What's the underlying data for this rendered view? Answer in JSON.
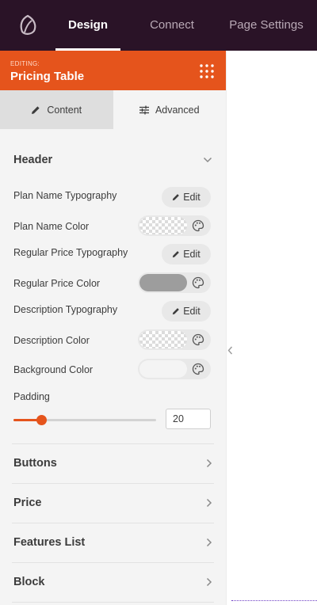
{
  "topbar": {
    "logo_icon": "seedprod-leaf-icon",
    "tabs": [
      {
        "label": "Design",
        "active": true
      },
      {
        "label": "Connect",
        "active": false
      },
      {
        "label": "Page Settings",
        "active": false
      }
    ]
  },
  "editing": {
    "label": "EDITING:",
    "title": "Pricing Table",
    "menu_icon": "grid-dots-icon"
  },
  "subtabs": [
    {
      "label": "Content",
      "icon": "pencil-icon",
      "active": true
    },
    {
      "label": "Advanced",
      "icon": "sliders-icon",
      "active": false
    }
  ],
  "header_section": {
    "title": "Header",
    "expanded": true,
    "rows": [
      {
        "label": "Plan Name Typography",
        "control": "edit",
        "button_label": "Edit"
      },
      {
        "label": "Plan Name Color",
        "control": "color",
        "value": "transparent"
      },
      {
        "label": "Regular Price Typography",
        "control": "edit",
        "button_label": "Edit"
      },
      {
        "label": "Regular Price Color",
        "control": "color",
        "value": "#9d9d9d"
      },
      {
        "label": "Description Typography",
        "control": "edit",
        "button_label": "Edit"
      },
      {
        "label": "Description Color",
        "control": "color",
        "value": "transparent"
      },
      {
        "label": "Background Color",
        "control": "color",
        "value": "#f4f4f4"
      }
    ],
    "padding": {
      "label": "Padding",
      "value": "20",
      "slider_fraction": 0.2
    }
  },
  "collapsed_sections": [
    {
      "title": "Buttons"
    },
    {
      "title": "Price"
    },
    {
      "title": "Features List"
    },
    {
      "title": "Block"
    }
  ],
  "colors": {
    "topbar": "#2a1327",
    "accent": "#e5541c",
    "panel": "#f4f4f4"
  }
}
